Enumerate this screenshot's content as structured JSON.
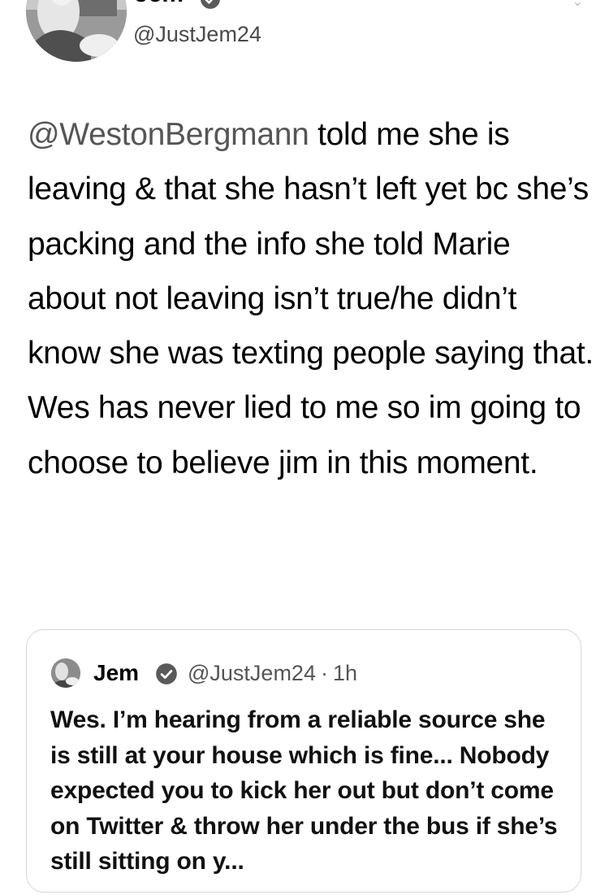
{
  "tweet": {
    "author": {
      "display_name": "Jem",
      "handle": "@JustJem24",
      "verified": true,
      "avatar": "profile-photo"
    },
    "text": {
      "mention": "@WestonBergmann",
      "body": " told me she is leaving & that she hasn’t left yet bc she’s packing and the info she told Marie about not leaving isn’t true/he didn’t know she was texting people saying that. Wes has never lied to me so im going to choose to believe jim in this moment."
    }
  },
  "quoted_tweet": {
    "display_name": "Jem",
    "verified": true,
    "handle": "@JustJem24",
    "separator": "·",
    "time": "1h",
    "text": "Wes. I’m hearing from a reliable source she is still at your house which is fine... Nobody expected you to kick her out but don’t come on Twitter & throw her under the bus if she’s still sitting on y..."
  },
  "colors": {
    "text": "#000000",
    "mention": "#555555",
    "secondary": "#555555",
    "border": "#d6d6d6"
  },
  "icons": {
    "verified": "verified-badge-icon"
  }
}
